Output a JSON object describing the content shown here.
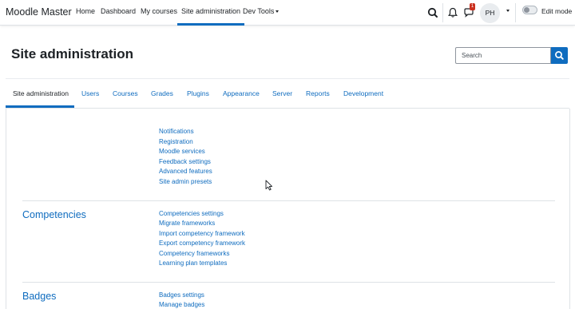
{
  "navbar": {
    "brand": "Moodle Master",
    "items": [
      "Home",
      "Dashboard",
      "My courses",
      "Site administration",
      "Dev Tools"
    ],
    "icons": [
      "search-icon",
      "bell-icon",
      "chat-icon"
    ],
    "message_count": "1",
    "avatar_initials": "PH",
    "edit_mode_label": "Edit mode",
    "edit_mode_on": false
  },
  "page": {
    "title": "Site administration",
    "search_placeholder": "Search"
  },
  "tabs": [
    "Site administration",
    "Users",
    "Courses",
    "Grades",
    "Plugins",
    "Appearance",
    "Server",
    "Reports",
    "Development"
  ],
  "sections": [
    {
      "heading": "",
      "links": [
        "Notifications",
        "Registration",
        "Moodle services",
        "Feedback settings",
        "Advanced features",
        "Site admin presets"
      ]
    },
    {
      "heading": "Competencies",
      "links": [
        "Competencies settings",
        "Migrate frameworks",
        "Import competency framework",
        "Export competency framework",
        "Competency frameworks",
        "Learning plan templates"
      ]
    },
    {
      "heading": "Badges",
      "links": [
        "Badges settings",
        "Manage badges"
      ]
    }
  ],
  "colors": {
    "accent": "#0f6cbf",
    "text": "#1d2125",
    "badge": "#ca3120",
    "border": "#dee2e6"
  }
}
